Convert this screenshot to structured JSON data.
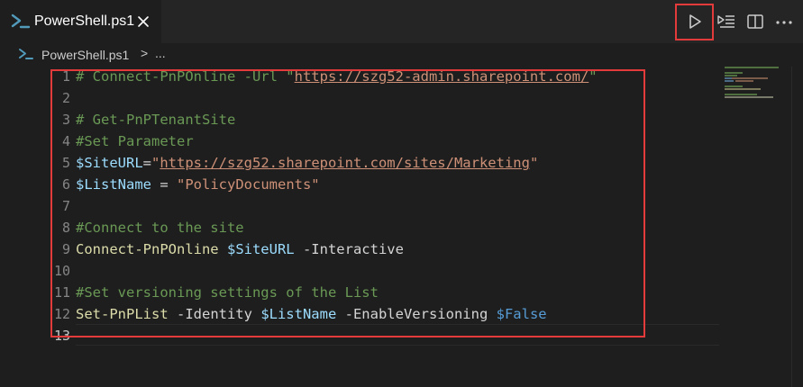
{
  "tab": {
    "title": "PowerShell.ps1",
    "icon": "powershell-icon"
  },
  "breadcrumb": {
    "file": "PowerShell.ps1",
    "separator": ">",
    "more": "..."
  },
  "editor_actions": [
    "run-icon",
    "run-selection-icon",
    "split-editor-icon",
    "more-actions-icon"
  ],
  "colors": {
    "highlight_border": "#e33b3b",
    "comment": "#6a9955",
    "variable": "#9cdcfe",
    "string": "#ce9178",
    "command": "#dcdcaa",
    "constant": "#569cd6"
  },
  "code_lines": [
    {
      "number": "1",
      "tokens": {
        "c1": "# Connect-PnPOnline -Url \"",
        "link": "https://szg52-admin.sharepoint.com/",
        "c2": "\""
      }
    },
    {
      "number": "2",
      "tokens": {}
    },
    {
      "number": "3",
      "tokens": {
        "c1": "# Get-PnPTenantSite"
      }
    },
    {
      "number": "4",
      "tokens": {
        "c1": "#Set Parameter"
      }
    },
    {
      "number": "5",
      "tokens": {
        "var": "$SiteURL",
        "eq": "=",
        "q1": "\"",
        "link": "https://szg52.sharepoint.com/sites/Marketing",
        "q2": "\""
      }
    },
    {
      "number": "6",
      "tokens": {
        "var": "$ListName",
        "eq": " = ",
        "str": "\"PolicyDocuments\""
      }
    },
    {
      "number": "7",
      "tokens": {}
    },
    {
      "number": "8",
      "tokens": {
        "c1": "#Connect to the site"
      }
    },
    {
      "number": "9",
      "tokens": {
        "cmd": "Connect-PnPOnline",
        "sp": " ",
        "var": "$SiteURL",
        "rest": " -Interactive"
      }
    },
    {
      "number": "10",
      "tokens": {}
    },
    {
      "number": "11",
      "tokens": {
        "c1": "#Set versioning settings of the List"
      }
    },
    {
      "number": "12",
      "tokens": {
        "cmd": "Set-PnPList",
        "a": " -Identity ",
        "var": "$ListName",
        "b": " -EnableVersioning ",
        "const": "$False"
      }
    },
    {
      "number": "13",
      "tokens": {}
    }
  ]
}
